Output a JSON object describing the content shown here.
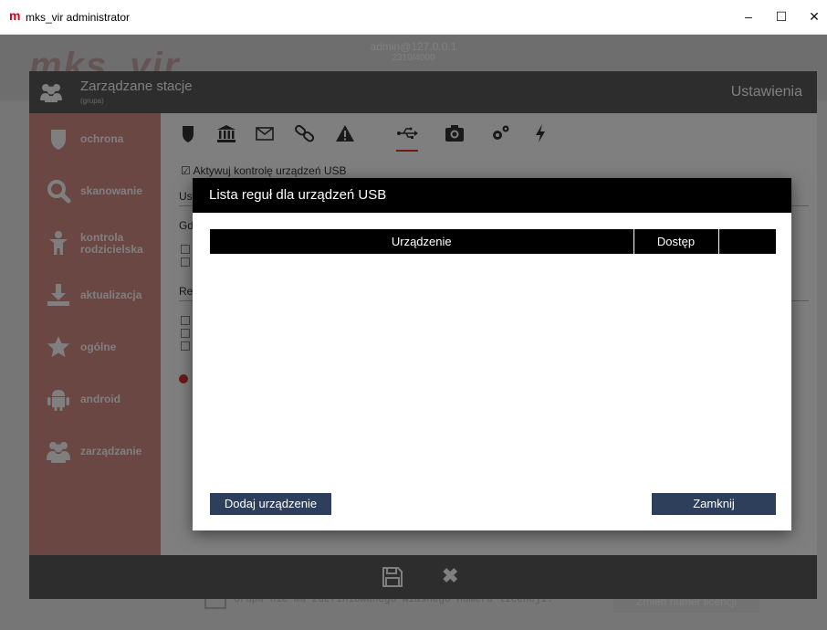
{
  "window": {
    "title": "mks_vir administrator",
    "logo_char": "m",
    "minimize": "–",
    "maximize": "☐",
    "close": "✕"
  },
  "background": {
    "user": "admin@127.0.0.1",
    "port": "2310/4000",
    "logo": "mks_vir",
    "help": "?",
    "bottom_text": "Grupa nie ma zdefiniowanego własnego numeru licencji.",
    "bottom_button": "Zmień numer licencji"
  },
  "panel": {
    "title": "Zarządzane stacje",
    "subtitle": "(grupa)",
    "settings": "Ustawienia"
  },
  "sidebar": {
    "items": [
      {
        "label": "ochrona",
        "icon": "shield-icon"
      },
      {
        "label": "skanowanie",
        "icon": "search-icon"
      },
      {
        "label": "kontrola rodzicielska",
        "icon": "child-icon"
      },
      {
        "label": "aktualizacja",
        "icon": "download-icon"
      },
      {
        "label": "ogólne",
        "icon": "star-icon"
      },
      {
        "label": "android",
        "icon": "android-icon"
      },
      {
        "label": "zarządzanie",
        "icon": "users-icon"
      }
    ]
  },
  "content": {
    "usb_checkbox_label": "Aktywuj kontrolę urządzeń USB",
    "frag_us": "Us",
    "frag_gd": "Gd",
    "frag_re": "Re"
  },
  "modal": {
    "title": "Lista reguł dla urządzeń USB",
    "columns": [
      "Urządzenie",
      "Dostęp",
      ""
    ],
    "rows": [],
    "add_button": "Dodaj urządzenie",
    "close_button": "Zamknij"
  },
  "colors": {
    "sidebar": "#d68f87",
    "header": "#5a5a5a",
    "button": "#2e3f5c",
    "accent": "#e0352b"
  }
}
